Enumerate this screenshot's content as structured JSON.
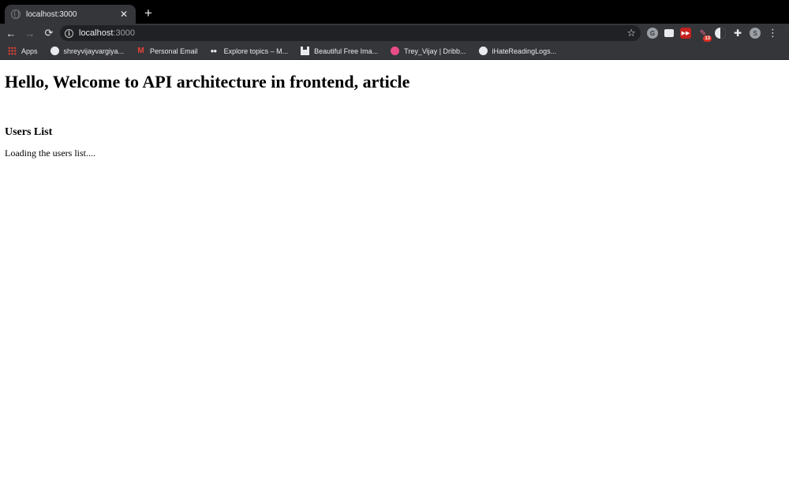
{
  "browser": {
    "tab": {
      "title": "localhost:3000",
      "close_glyph": "✕",
      "favicon": "globe-icon"
    },
    "new_tab_glyph": "+",
    "toolbar": {
      "back_glyph": "←",
      "forward_glyph": "→",
      "reload_glyph": "⟳",
      "url_host": "localhost",
      "url_port": ":3000",
      "star_glyph": "☆",
      "profile_initial": "S",
      "badge_count": "13",
      "menu_glyph": "⋮"
    },
    "bookmarks": [
      {
        "label": "Apps",
        "icon": "apps-grid-icon"
      },
      {
        "label": "shreyvijayvargiya...",
        "icon": "github-icon"
      },
      {
        "label": "Personal Email",
        "icon": "gmail-icon"
      },
      {
        "label": "Explore topics – M...",
        "icon": "medium-icon"
      },
      {
        "label": "Beautiful Free Ima...",
        "icon": "unsplash-icon"
      },
      {
        "label": "Trey_Vijay | Dribb...",
        "icon": "dribbble-icon"
      },
      {
        "label": "iHateReadingLogs...",
        "icon": "github-icon"
      }
    ]
  },
  "page": {
    "heading": "Hello, Welcome to API architecture in frontend, article",
    "section_title": "Users List",
    "status_text": "Loading the users list...."
  },
  "colors": {
    "chrome_frame": "#000000",
    "chrome_toolbar": "#35363a",
    "omnibox": "#202124",
    "page_background": "#ffffff"
  }
}
